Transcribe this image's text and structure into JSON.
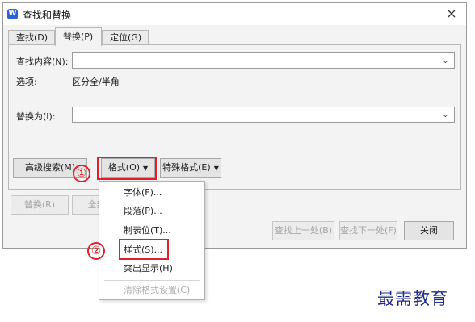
{
  "window": {
    "title": "查找和替换",
    "app_icon_text": "W",
    "close_glyph": "×"
  },
  "tabs": [
    {
      "label": "查找(D)"
    },
    {
      "label": "替换(P)"
    },
    {
      "label": "定位(G)"
    }
  ],
  "active_tab": "替换(P)",
  "find": {
    "label": "查找内容(N):",
    "value": ""
  },
  "options": {
    "label": "选项:",
    "value": "区分全/半角"
  },
  "replace": {
    "label": "替换为(I):",
    "value": ""
  },
  "buttons": {
    "advanced_search": "高级搜索(M)",
    "format": "格式(O)",
    "special_format": "特殊格式(E)",
    "replace": "替换(R)",
    "replace_all": "全部替",
    "find_prev": "查找上一处(B)",
    "find_next": "查找下一处(F)",
    "close": "关闭"
  },
  "format_menu": {
    "items": [
      {
        "label": "字体(F)...",
        "enabled": true
      },
      {
        "label": "段落(P)...",
        "enabled": true
      },
      {
        "label": "制表位(T)...",
        "enabled": true
      },
      {
        "label": "样式(S)...",
        "enabled": true
      },
      {
        "label": "突出显示(H)",
        "enabled": true
      },
      {
        "label": "清除格式设置(C)",
        "enabled": false
      }
    ]
  },
  "annotations": {
    "step1": "①",
    "step2": "②",
    "highlight_color": "#e0202a"
  },
  "watermark": "最需教育"
}
